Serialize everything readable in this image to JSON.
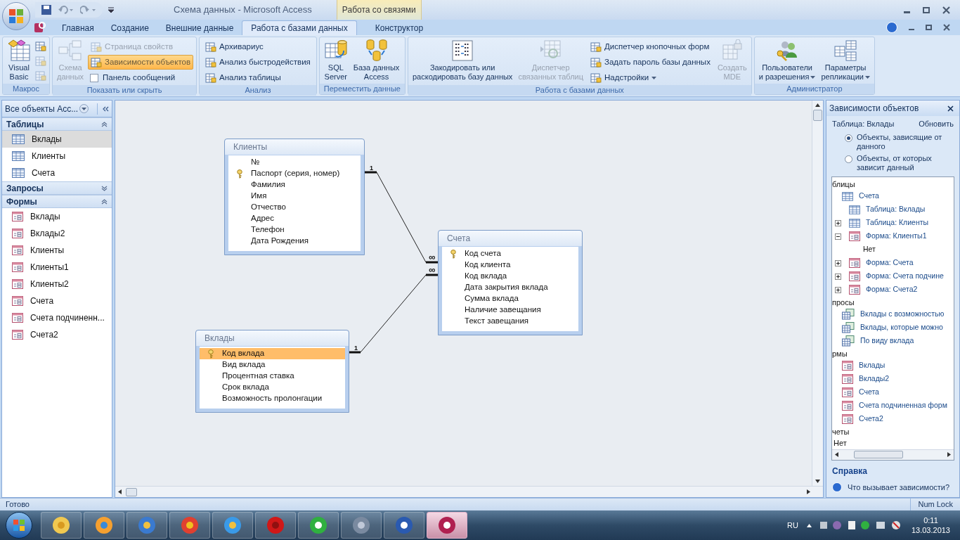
{
  "window": {
    "title": "Схема данных - Microsoft Access",
    "context_tab": "Работа со связями"
  },
  "tabs": [
    {
      "label": "Главная",
      "selected": false
    },
    {
      "label": "Создание",
      "selected": false
    },
    {
      "label": "Внешние данные",
      "selected": false
    },
    {
      "label": "Работа с базами данных",
      "selected": true
    },
    {
      "label": "Конструктор",
      "selected": false
    }
  ],
  "ribbon": {
    "groups": [
      {
        "title": "Макрос",
        "items": [
          {
            "kind": "large",
            "lines": [
              "Visual",
              "Basic"
            ],
            "disabled": false
          },
          {
            "kind": "icon_column"
          }
        ]
      },
      {
        "title": "Показать или скрыть",
        "items": [
          {
            "kind": "large",
            "lines": [
              "Схема",
              "данных"
            ],
            "disabled": true
          },
          {
            "kind": "stack",
            "entries": [
              {
                "kind": "small",
                "label": "Страница свойств",
                "disabled": true,
                "selected": false
              },
              {
                "kind": "small",
                "label": "Зависимости объектов",
                "disabled": false,
                "selected": true
              },
              {
                "kind": "checkbox",
                "label": "Панель сообщений",
                "checked": false
              }
            ]
          }
        ]
      },
      {
        "title": "Анализ",
        "items": [
          {
            "kind": "stack",
            "entries": [
              {
                "kind": "small",
                "label": "Архивариус",
                "disabled": false,
                "selected": false
              },
              {
                "kind": "small",
                "label": "Анализ быстродействия",
                "disabled": false,
                "selected": false
              },
              {
                "kind": "small",
                "label": "Анализ таблицы",
                "disabled": false,
                "selected": false
              }
            ]
          }
        ]
      },
      {
        "title": "Переместить данные",
        "items": [
          {
            "kind": "large",
            "lines": [
              "SQL",
              "Server"
            ],
            "disabled": false
          },
          {
            "kind": "large",
            "lines": [
              "База данных",
              "Access"
            ],
            "disabled": false
          }
        ]
      },
      {
        "title": "Работа с базами данных",
        "items": [
          {
            "kind": "large",
            "lines": [
              "Закодировать или",
              "раскодировать базу данных"
            ],
            "disabled": false
          },
          {
            "kind": "large",
            "lines": [
              "Диспетчер",
              "связанных таблиц"
            ],
            "disabled": true
          },
          {
            "kind": "stack",
            "entries": [
              {
                "kind": "small",
                "label": "Диспетчер кнопочных форм",
                "disabled": false,
                "selected": false
              },
              {
                "kind": "small",
                "label": "Задать пароль базы данных",
                "disabled": false,
                "selected": false
              },
              {
                "kind": "menu",
                "label": "Надстройки",
                "disabled": false,
                "selected": false
              }
            ]
          },
          {
            "kind": "large",
            "lines": [
              "Создать",
              "MDE"
            ],
            "disabled": true
          }
        ]
      },
      {
        "title": "Администратор",
        "items": [
          {
            "kind": "large_menu",
            "lines": [
              "Пользователи",
              "и разрешения"
            ],
            "disabled": false
          },
          {
            "kind": "large_menu",
            "lines": [
              "Параметры",
              "репликации"
            ],
            "disabled": false
          }
        ]
      }
    ]
  },
  "nav": {
    "title": "Все объекты Acc...",
    "groups": [
      {
        "title": "Таблицы",
        "expanded": true,
        "items": [
          {
            "label": "Вклады",
            "kind": "table",
            "selected": true
          },
          {
            "label": "Клиенты",
            "kind": "table",
            "selected": false
          },
          {
            "label": "Счета",
            "kind": "table",
            "selected": false
          }
        ]
      },
      {
        "title": "Запросы",
        "expanded": false
      },
      {
        "title": "Формы",
        "expanded": true,
        "items": [
          {
            "label": "Вклады",
            "kind": "form",
            "selected": false
          },
          {
            "label": "Вклады2",
            "kind": "form",
            "selected": false
          },
          {
            "label": "Клиенты",
            "kind": "form",
            "selected": false
          },
          {
            "label": "Клиенты1",
            "kind": "form",
            "selected": false
          },
          {
            "label": "Клиенты2",
            "kind": "form",
            "selected": false
          },
          {
            "label": "Счета",
            "kind": "form",
            "selected": false
          },
          {
            "label": "Счета подчиненн...",
            "kind": "form",
            "selected": false
          },
          {
            "label": "Счета2",
            "kind": "form",
            "selected": false
          }
        ]
      }
    ]
  },
  "diagram": {
    "tables": [
      {
        "title": "Клиенты",
        "fields": [
          {
            "name": "№",
            "key": false,
            "selected": false
          },
          {
            "name": "Паспорт (серия, номер)",
            "key": true,
            "selected": false
          },
          {
            "name": "Фамилия",
            "key": false,
            "selected": false
          },
          {
            "name": "Имя",
            "key": false,
            "selected": false
          },
          {
            "name": "Отчество",
            "key": false,
            "selected": false
          },
          {
            "name": "Адрес",
            "key": false,
            "selected": false
          },
          {
            "name": "Телефон",
            "key": false,
            "selected": false
          },
          {
            "name": "Дата Рождения",
            "key": false,
            "selected": false
          }
        ]
      },
      {
        "title": "Счета",
        "fields": [
          {
            "name": "Код счета",
            "key": true,
            "selected": false
          },
          {
            "name": "Код клиента",
            "key": false,
            "selected": false
          },
          {
            "name": "Код вклада",
            "key": false,
            "selected": false
          },
          {
            "name": "Дата закрытия вклада",
            "key": false,
            "selected": false
          },
          {
            "name": "Сумма вклада",
            "key": false,
            "selected": false
          },
          {
            "name": "Наличие завещания",
            "key": false,
            "selected": false
          },
          {
            "name": "Текст завещания",
            "key": false,
            "selected": false
          }
        ]
      },
      {
        "title": "Вклады",
        "fields": [
          {
            "name": "Код вклада",
            "key": true,
            "selected": true
          },
          {
            "name": "Вид вклада",
            "key": false,
            "selected": false
          },
          {
            "name": "Процентная ставка",
            "key": false,
            "selected": false
          },
          {
            "name": "Срок вклада",
            "key": false,
            "selected": false
          },
          {
            "name": "Возможность пролонгации",
            "key": false,
            "selected": false
          }
        ]
      }
    ],
    "relationships": [
      {
        "one": "1",
        "many": "∞"
      },
      {
        "one": "1",
        "many": "∞"
      }
    ]
  },
  "pane": {
    "title": "Зависимости объектов",
    "object": "Таблица: Вклады",
    "refresh": "Обновить",
    "options": [
      {
        "label": "Объекты, зависящие от данного",
        "selected": true
      },
      {
        "label": "Объекты, от которых зависит данный",
        "selected": false
      }
    ],
    "sections": [
      {
        "title": "блицы",
        "items": [
          {
            "label": "Счета",
            "kind": "table",
            "children": [
              {
                "label": "Таблица: Вклады",
                "kind": "table"
              },
              {
                "label": "Таблица: Клиенты",
                "kind": "table",
                "expanded": false
              },
              {
                "label": "Форма: Клиенты1",
                "kind": "form",
                "expanded": true,
                "children": [
                  {
                    "label": "Нет",
                    "kind": "none"
                  }
                ]
              },
              {
                "label": "Форма: Счета",
                "kind": "form",
                "expanded": false
              },
              {
                "label": "Форма: Счета подчине",
                "kind": "form",
                "expanded": false
              },
              {
                "label": "Форма: Счета2",
                "kind": "form",
                "expanded": false
              }
            ]
          }
        ]
      },
      {
        "title": "просы",
        "items": [
          {
            "label": "Вклады с возможностью",
            "kind": "query"
          },
          {
            "label": "Вклады, которые можно",
            "kind": "query"
          },
          {
            "label": "По виду вклада",
            "kind": "query"
          }
        ]
      },
      {
        "title": "рмы",
        "items": [
          {
            "label": "Вклады",
            "kind": "form"
          },
          {
            "label": "Вклады2",
            "kind": "form"
          },
          {
            "label": "Счета",
            "kind": "form"
          },
          {
            "label": "Счета подчиненная форм",
            "kind": "form"
          },
          {
            "label": "Счета2",
            "kind": "form"
          }
        ]
      },
      {
        "title": "четы",
        "items": [
          {
            "label": "Нет",
            "kind": "none"
          }
        ]
      }
    ],
    "help_title": "Справка",
    "help_link": "Что вызывает зависимости?"
  },
  "status_bar": {
    "left": "Готово",
    "right": "Num Lock"
  },
  "taskbar": {
    "apps": [
      {
        "kind": "folder",
        "selected": false
      },
      {
        "kind": "media",
        "selected": false
      },
      {
        "kind": "paint",
        "selected": false
      },
      {
        "kind": "globe",
        "selected": false
      },
      {
        "kind": "ie",
        "selected": false
      },
      {
        "kind": "opera",
        "selected": false
      },
      {
        "kind": "mail",
        "selected": false
      },
      {
        "kind": "cube",
        "selected": false
      },
      {
        "kind": "word",
        "selected": false
      },
      {
        "kind": "access",
        "selected": true
      }
    ],
    "language": "RU",
    "time": "0:11",
    "date": "13.03.2013"
  }
}
